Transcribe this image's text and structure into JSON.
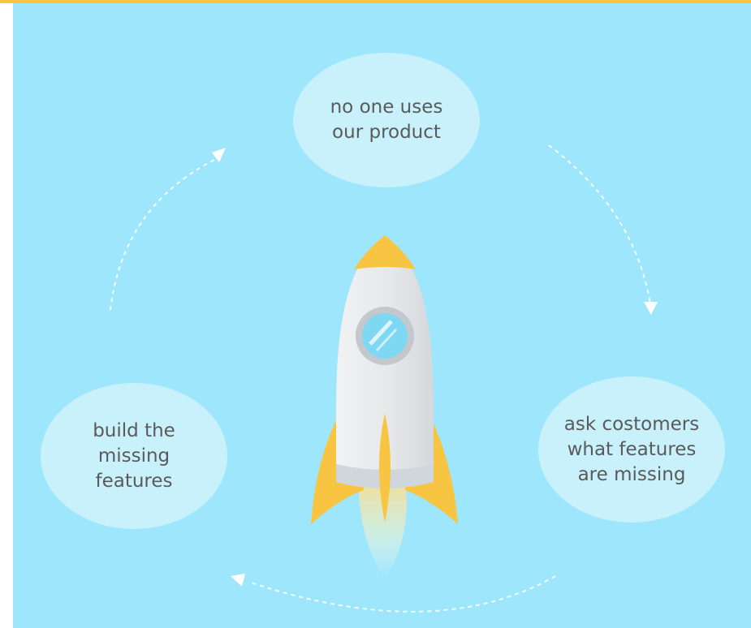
{
  "steps": [
    {
      "text": "no one uses\nour product"
    },
    {
      "text": "ask costomers\nwhat features\nare missing"
    },
    {
      "text": "build the\nmissing\nfeatures"
    }
  ],
  "colors": {
    "accent_bar": "#f7c541",
    "background": "#9de6fb",
    "bubble": "#c9f1fc",
    "text": "#5a5a5a",
    "rocket_body": "#e8eaec",
    "rocket_fin": "#f7c541",
    "window_glass": "#7fd8f2",
    "arrow": "#ffffff"
  }
}
